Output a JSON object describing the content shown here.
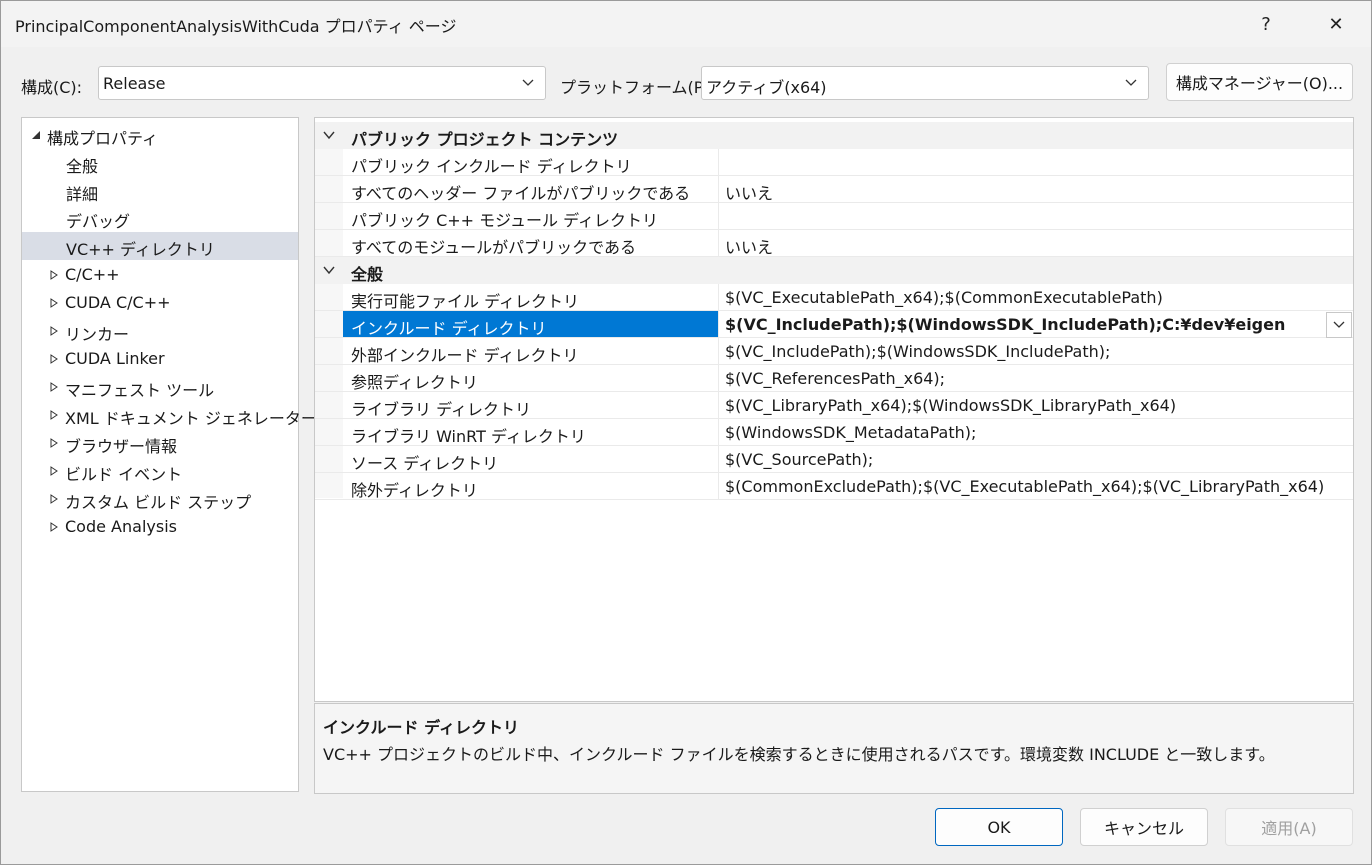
{
  "window": {
    "title": "PrincipalComponentAnalysisWithCuda プロパティ ページ",
    "help_label": "?",
    "close_label": "✕"
  },
  "toolbar": {
    "config_label": "構成(C):",
    "config_value": "Release",
    "platform_label": "プラットフォーム(P):",
    "platform_value": "アクティブ(x64)",
    "config_manager_label": "構成マネージャー(O)..."
  },
  "tree": {
    "items": [
      {
        "label": "構成プロパティ",
        "expanded": true
      },
      {
        "label": "全般"
      },
      {
        "label": "詳細"
      },
      {
        "label": "デバッグ"
      },
      {
        "label": "VC++ ディレクトリ",
        "selected": true
      },
      {
        "label": "C/C++"
      },
      {
        "label": "CUDA C/C++"
      },
      {
        "label": "リンカー"
      },
      {
        "label": "CUDA Linker"
      },
      {
        "label": "マニフェスト ツール"
      },
      {
        "label": "XML ドキュメント ジェネレーター"
      },
      {
        "label": "ブラウザー情報"
      },
      {
        "label": "ビルド イベント"
      },
      {
        "label": "カスタム ビルド ステップ"
      },
      {
        "label": "Code Analysis"
      }
    ]
  },
  "grid": {
    "categories": [
      {
        "label": "パブリック プロジェクト コンテンツ",
        "rows": [
          {
            "key": "パブリック インクルード ディレクトリ",
            "value": ""
          },
          {
            "key": "すべてのヘッダー ファイルがパブリックである",
            "value": "いいえ"
          },
          {
            "key": "パブリック C++ モジュール ディレクトリ",
            "value": ""
          },
          {
            "key": "すべてのモジュールがパブリックである",
            "value": "いいえ"
          }
        ]
      },
      {
        "label": "全般",
        "rows": [
          {
            "key": "実行可能ファイル ディレクトリ",
            "value": "$(VC_ExecutablePath_x64);$(CommonExecutablePath)"
          },
          {
            "key": "インクルード ディレクトリ",
            "value": "$(VC_IncludePath);$(WindowsSDK_IncludePath);C:¥dev¥eigen"
          },
          {
            "key": "外部インクルード ディレクトリ",
            "value": "$(VC_IncludePath);$(WindowsSDK_IncludePath);"
          },
          {
            "key": "参照ディレクトリ",
            "value": "$(VC_ReferencesPath_x64);"
          },
          {
            "key": "ライブラリ ディレクトリ",
            "value": "$(VC_LibraryPath_x64);$(WindowsSDK_LibraryPath_x64)"
          },
          {
            "key": "ライブラリ WinRT ディレクトリ",
            "value": "$(WindowsSDK_MetadataPath);"
          },
          {
            "key": "ソース ディレクトリ",
            "value": "$(VC_SourcePath);"
          },
          {
            "key": "除外ディレクトリ",
            "value": "$(CommonExcludePath);$(VC_ExecutablePath_x64);$(VC_LibraryPath_x64)"
          }
        ]
      }
    ]
  },
  "description": {
    "title": "インクルード ディレクトリ",
    "text": "VC++ プロジェクトのビルド中、インクルード ファイルを検索するときに使用されるパスです。環境変数 INCLUDE と一致します。"
  },
  "buttons": {
    "ok": "OK",
    "cancel": "キャンセル",
    "apply": "適用(A)"
  }
}
